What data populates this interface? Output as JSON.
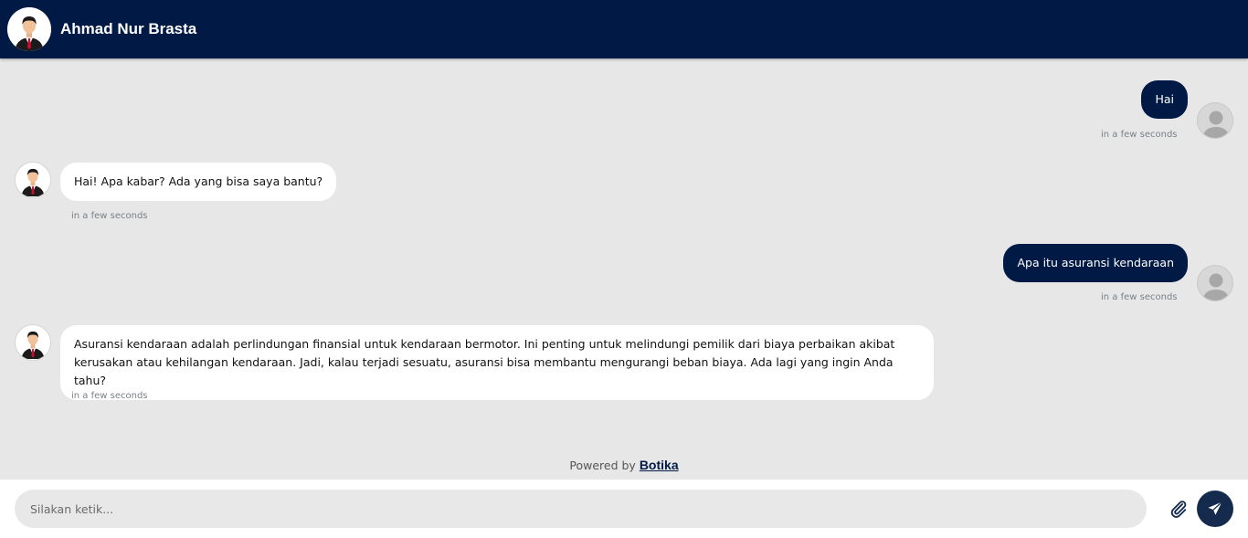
{
  "header": {
    "title": "Ahmad Nur Brasta",
    "avatar_icon": "businessman-avatar-icon"
  },
  "messages": [
    {
      "from": "user",
      "text": "Hai",
      "time": "in a few seconds"
    },
    {
      "from": "bot",
      "text": "Hai! Apa kabar? Ada yang bisa saya bantu?",
      "time": "in a few seconds"
    },
    {
      "from": "user",
      "text": "Apa itu asuransi kendaraan",
      "time": "in a few seconds"
    },
    {
      "from": "bot",
      "text": "Asuransi kendaraan adalah perlindungan finansial untuk kendaraan bermotor. Ini penting untuk melindungi pemilik dari biaya perbaikan akibat kerusakan atau kehilangan kendaraan. Jadi, kalau terjadi sesuatu, asuransi bisa membantu mengurangi beban biaya. Ada lagi yang ingin Anda tahu?",
      "time": "in a few seconds"
    }
  ],
  "footer": {
    "powered_prefix": "Powered by",
    "powered_brand": "Botika",
    "input_placeholder": "Silakan ketik...",
    "attach_icon": "paperclip-icon",
    "send_icon": "paper-plane-icon"
  },
  "colors": {
    "header_bg": "#001a45",
    "user_bubble": "#001a45",
    "bot_bubble": "#ffffff",
    "background": "#e7e7e7",
    "send_button": "#142b4e"
  }
}
